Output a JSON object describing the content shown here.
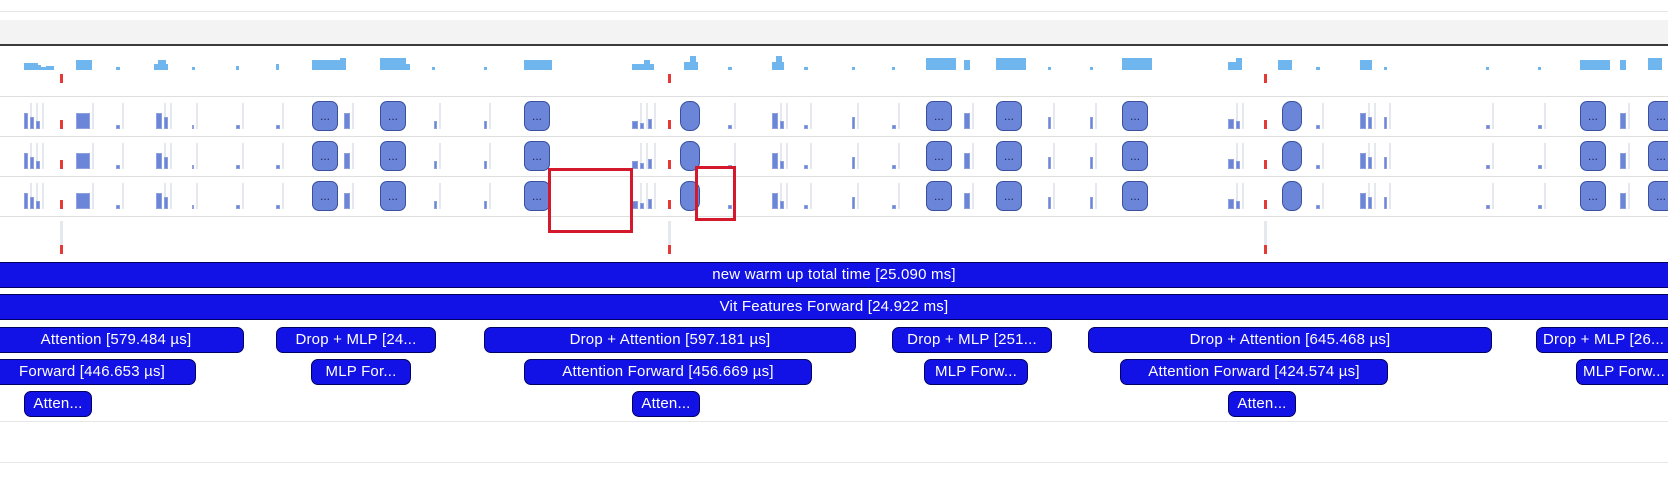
{
  "timeline": {
    "spans": [
      {
        "label": "new warm up total time [25.090 ms]"
      },
      {
        "label": "Vit Features Forward [24.922 ms]"
      },
      {
        "label": "Attention [579.484 µs]"
      },
      {
        "label": "Drop + MLP [24..."
      },
      {
        "label": "Drop + Attention [597.181 µs]"
      },
      {
        "label": "Drop + MLP [251..."
      },
      {
        "label": "Drop + Attention [645.468 µs]"
      },
      {
        "label": "Drop + MLP [26..."
      },
      {
        "label": "Forward [446.653 µs]"
      },
      {
        "label": "MLP For..."
      },
      {
        "label": "Attention Forward [456.669 µs]"
      },
      {
        "label": "MLP Forw..."
      },
      {
        "label": "Attention Forward [424.574 µs]"
      },
      {
        "label": "MLP Forw..."
      },
      {
        "label": "Atten..."
      },
      {
        "label": "Atten..."
      },
      {
        "label": "Atten..."
      }
    ],
    "collapsed_glyph": "...",
    "colors": {
      "span_fill": "#1212e6",
      "span_border": "#000060",
      "activity": "#6fb5ee",
      "kernel_node": "#6b86d8",
      "marker": "#e53935",
      "highlight": "#d3192b"
    }
  }
}
